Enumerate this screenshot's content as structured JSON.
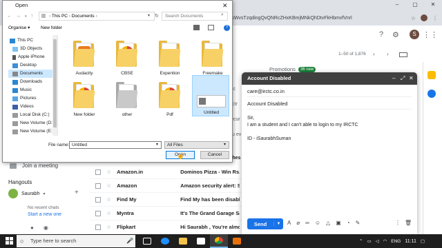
{
  "browser": {
    "address_fragment": "QsWvsTzqdingQvQNRcZHxKBmjMNkQhDtvFkHbmvfVnrl",
    "window_controls": [
      "–",
      "▢",
      "✕"
    ]
  },
  "gmail": {
    "avatar_letter": "S",
    "page_count": "1–50 of 1,876",
    "promotions": {
      "label": "Promotions",
      "badge": "36 new"
    },
    "join_meeting": "Join a meeting",
    "hangouts": {
      "title": "Hangouts",
      "user": "Saurabh",
      "no_recent": "No recent chats",
      "start_new": "Start a new one"
    },
    "mail_rows": [
      {
        "sender": "Amazon.in",
        "subject": "Dominos Pizza - Win Rs.1"
      },
      {
        "sender": "Amazon",
        "subject": "Amazon security alert: Sig"
      },
      {
        "sender": "Find My",
        "subject": "Find My has been disabled"
      },
      {
        "sender": "Myntra",
        "subject": "It's The Grand Garage Sale"
      },
      {
        "sender": "Flipkart",
        "subject": "Hi Saurabh , You're almost"
      }
    ],
    "background_snippets": [
      "rvic",
      "ctr",
      "ecur",
      "u ev",
      "thes"
    ]
  },
  "compose": {
    "title": "Account Disabled",
    "controls": [
      "–",
      "⤢",
      "✕"
    ],
    "to": "care@irctc.co.in",
    "subject": "Account Disabled",
    "body_lines": [
      "Sir,",
      "I am a student and I can't able to login to my IRCTC",
      "",
      "ID - iSaurabhSuman"
    ],
    "send_label": "Send"
  },
  "dialog": {
    "title": "Open",
    "close": "✕",
    "breadcrumb": [
      "This PC",
      "Documents"
    ],
    "search_placeholder": "Search Documents",
    "organise": "Organise ▾",
    "new_folder": "New folder",
    "tree": [
      {
        "label": "This PC",
        "icon": "pc-icon"
      },
      {
        "label": "3D Objects",
        "icon": "cube-icon"
      },
      {
        "label": "Apple iPhone",
        "icon": "phone-icon"
      },
      {
        "label": "Desktop",
        "icon": "desktop-icon"
      },
      {
        "label": "Documents",
        "icon": "documents-icon",
        "selected": true
      },
      {
        "label": "Downloads",
        "icon": "download-icon"
      },
      {
        "label": "Music",
        "icon": "music-icon"
      },
      {
        "label": "Pictures",
        "icon": "pictures-icon"
      },
      {
        "label": "Videos",
        "icon": "videos-icon"
      },
      {
        "label": "Local Disk (C:)",
        "icon": "disk-icon"
      },
      {
        "label": "New Volume (D:",
        "icon": "disk-icon"
      },
      {
        "label": "New Volume (E:)",
        "icon": "disk-icon"
      }
    ],
    "files": [
      {
        "label": "Audacity",
        "kind": "folder"
      },
      {
        "label": "CBSE",
        "kind": "folder-chrome"
      },
      {
        "label": "Expention",
        "kind": "folder"
      },
      {
        "label": "Freemake",
        "kind": "folder"
      },
      {
        "label": "New folder",
        "kind": "folder-chrome"
      },
      {
        "label": "other",
        "kind": "folder-gray"
      },
      {
        "label": "Pdf",
        "kind": "folder-chrome"
      },
      {
        "label": "Untitled",
        "kind": "image",
        "selected": true
      }
    ],
    "file_name_label": "File name:",
    "file_name_value": "Untitled",
    "file_type": "All Files",
    "open_label": "Open",
    "cancel_label": "Cancel"
  },
  "taskbar": {
    "search_placeholder": "Type here to search",
    "tray_lang": "ENG",
    "time": "11:11"
  }
}
